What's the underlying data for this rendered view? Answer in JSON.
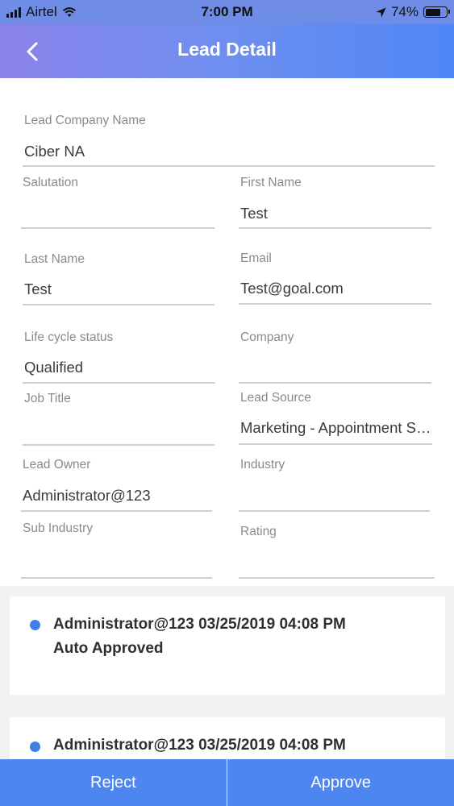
{
  "status_bar": {
    "carrier": "Airtel",
    "time": "7:00 PM",
    "battery": "74%",
    "battery_level": 0.74,
    "icons": [
      "signal-icon",
      "wifi-icon",
      "location-arrow-icon",
      "battery-icon"
    ]
  },
  "header": {
    "title": "Lead Detail",
    "back_icon": "chevron-left-icon"
  },
  "form": {
    "lead_company_name": {
      "label": "Lead Company Name",
      "value": "Ciber NA"
    },
    "salutation": {
      "label": "Salutation",
      "value": ""
    },
    "first_name": {
      "label": "First Name",
      "value": "Test"
    },
    "last_name": {
      "label": "Last Name",
      "value": "Test"
    },
    "email": {
      "label": "Email",
      "value": "Test@goal.com"
    },
    "life_cycle_status": {
      "label": "Life cycle status",
      "value": "Qualified"
    },
    "company": {
      "label": "Company",
      "value": ""
    },
    "job_title": {
      "label": "Job Title",
      "value": ""
    },
    "lead_source": {
      "label": "Lead Source",
      "value": "Marketing - Appointment Se..."
    },
    "lead_owner": {
      "label": "Lead Owner",
      "value": "Administrator@123"
    },
    "industry": {
      "label": "Industry",
      "value": ""
    },
    "sub_industry": {
      "label": "Sub Industry",
      "value": ""
    },
    "rating": {
      "label": "Rating",
      "value": ""
    }
  },
  "activity": [
    {
      "author_date": "Administrator@123 03/25/2019 04:08 PM",
      "status": "Auto Approved"
    },
    {
      "author_date": "Administrator@123 03/25/2019 04:08 PM",
      "status": ""
    }
  ],
  "actions": {
    "reject": "Reject",
    "approve": "Approve"
  },
  "colors": {
    "accent": "#4d86f0",
    "dot": "#3f7fe8",
    "header_gradient_start": "#8a83ea",
    "header_gradient_end": "#4f86f6"
  }
}
